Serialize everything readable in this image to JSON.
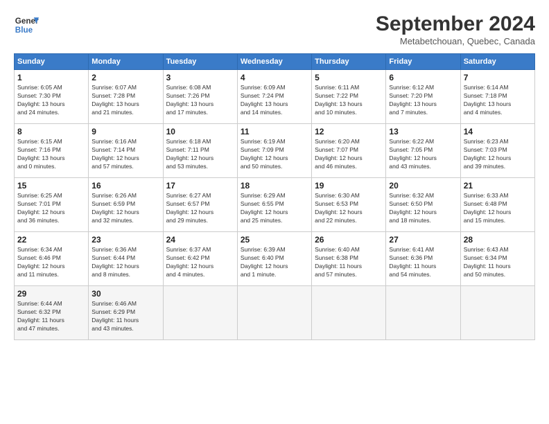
{
  "header": {
    "logo_line1": "General",
    "logo_line2": "Blue",
    "month": "September 2024",
    "location": "Metabetchouan, Quebec, Canada"
  },
  "days_of_week": [
    "Sunday",
    "Monday",
    "Tuesday",
    "Wednesday",
    "Thursday",
    "Friday",
    "Saturday"
  ],
  "weeks": [
    [
      {
        "day": "1",
        "info": "Sunrise: 6:05 AM\nSunset: 7:30 PM\nDaylight: 13 hours\nand 24 minutes."
      },
      {
        "day": "2",
        "info": "Sunrise: 6:07 AM\nSunset: 7:28 PM\nDaylight: 13 hours\nand 21 minutes."
      },
      {
        "day": "3",
        "info": "Sunrise: 6:08 AM\nSunset: 7:26 PM\nDaylight: 13 hours\nand 17 minutes."
      },
      {
        "day": "4",
        "info": "Sunrise: 6:09 AM\nSunset: 7:24 PM\nDaylight: 13 hours\nand 14 minutes."
      },
      {
        "day": "5",
        "info": "Sunrise: 6:11 AM\nSunset: 7:22 PM\nDaylight: 13 hours\nand 10 minutes."
      },
      {
        "day": "6",
        "info": "Sunrise: 6:12 AM\nSunset: 7:20 PM\nDaylight: 13 hours\nand 7 minutes."
      },
      {
        "day": "7",
        "info": "Sunrise: 6:14 AM\nSunset: 7:18 PM\nDaylight: 13 hours\nand 4 minutes."
      }
    ],
    [
      {
        "day": "8",
        "info": "Sunrise: 6:15 AM\nSunset: 7:16 PM\nDaylight: 13 hours\nand 0 minutes."
      },
      {
        "day": "9",
        "info": "Sunrise: 6:16 AM\nSunset: 7:14 PM\nDaylight: 12 hours\nand 57 minutes."
      },
      {
        "day": "10",
        "info": "Sunrise: 6:18 AM\nSunset: 7:11 PM\nDaylight: 12 hours\nand 53 minutes."
      },
      {
        "day": "11",
        "info": "Sunrise: 6:19 AM\nSunset: 7:09 PM\nDaylight: 12 hours\nand 50 minutes."
      },
      {
        "day": "12",
        "info": "Sunrise: 6:20 AM\nSunset: 7:07 PM\nDaylight: 12 hours\nand 46 minutes."
      },
      {
        "day": "13",
        "info": "Sunrise: 6:22 AM\nSunset: 7:05 PM\nDaylight: 12 hours\nand 43 minutes."
      },
      {
        "day": "14",
        "info": "Sunrise: 6:23 AM\nSunset: 7:03 PM\nDaylight: 12 hours\nand 39 minutes."
      }
    ],
    [
      {
        "day": "15",
        "info": "Sunrise: 6:25 AM\nSunset: 7:01 PM\nDaylight: 12 hours\nand 36 minutes."
      },
      {
        "day": "16",
        "info": "Sunrise: 6:26 AM\nSunset: 6:59 PM\nDaylight: 12 hours\nand 32 minutes."
      },
      {
        "day": "17",
        "info": "Sunrise: 6:27 AM\nSunset: 6:57 PM\nDaylight: 12 hours\nand 29 minutes."
      },
      {
        "day": "18",
        "info": "Sunrise: 6:29 AM\nSunset: 6:55 PM\nDaylight: 12 hours\nand 25 minutes."
      },
      {
        "day": "19",
        "info": "Sunrise: 6:30 AM\nSunset: 6:53 PM\nDaylight: 12 hours\nand 22 minutes."
      },
      {
        "day": "20",
        "info": "Sunrise: 6:32 AM\nSunset: 6:50 PM\nDaylight: 12 hours\nand 18 minutes."
      },
      {
        "day": "21",
        "info": "Sunrise: 6:33 AM\nSunset: 6:48 PM\nDaylight: 12 hours\nand 15 minutes."
      }
    ],
    [
      {
        "day": "22",
        "info": "Sunrise: 6:34 AM\nSunset: 6:46 PM\nDaylight: 12 hours\nand 11 minutes."
      },
      {
        "day": "23",
        "info": "Sunrise: 6:36 AM\nSunset: 6:44 PM\nDaylight: 12 hours\nand 8 minutes."
      },
      {
        "day": "24",
        "info": "Sunrise: 6:37 AM\nSunset: 6:42 PM\nDaylight: 12 hours\nand 4 minutes."
      },
      {
        "day": "25",
        "info": "Sunrise: 6:39 AM\nSunset: 6:40 PM\nDaylight: 12 hours\nand 1 minute."
      },
      {
        "day": "26",
        "info": "Sunrise: 6:40 AM\nSunset: 6:38 PM\nDaylight: 11 hours\nand 57 minutes."
      },
      {
        "day": "27",
        "info": "Sunrise: 6:41 AM\nSunset: 6:36 PM\nDaylight: 11 hours\nand 54 minutes."
      },
      {
        "day": "28",
        "info": "Sunrise: 6:43 AM\nSunset: 6:34 PM\nDaylight: 11 hours\nand 50 minutes."
      }
    ],
    [
      {
        "day": "29",
        "info": "Sunrise: 6:44 AM\nSunset: 6:32 PM\nDaylight: 11 hours\nand 47 minutes."
      },
      {
        "day": "30",
        "info": "Sunrise: 6:46 AM\nSunset: 6:29 PM\nDaylight: 11 hours\nand 43 minutes."
      },
      {
        "day": "",
        "info": ""
      },
      {
        "day": "",
        "info": ""
      },
      {
        "day": "",
        "info": ""
      },
      {
        "day": "",
        "info": ""
      },
      {
        "day": "",
        "info": ""
      }
    ]
  ]
}
